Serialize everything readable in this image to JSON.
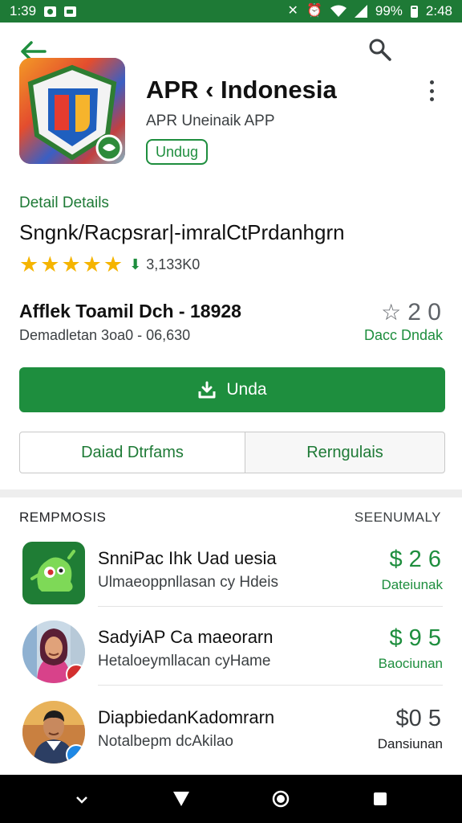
{
  "status_bar": {
    "time": "1:39",
    "battery_text": "99%",
    "clock_right": "2:48"
  },
  "app": {
    "title": "APR ‹ Indonesia",
    "subtitle": "APR Uneinaik APP",
    "chip": "Undug"
  },
  "details": {
    "label": "Detail Details",
    "title": "Sngnk/Racpsrar|-imralCtPrdanhgrn",
    "rating_stars": 5,
    "rating_count": "3,133K0"
  },
  "info": {
    "title": "Afflek Toamil Dch - 18928",
    "subtitle": "Demadletan 3oa0 - 06,630",
    "favorite_count": "2 0",
    "favorite_label": "Dacc Dndak"
  },
  "actions": {
    "install_label": "Unda",
    "left_button": "Daiad Dtrfams",
    "right_button": "Rerngulais"
  },
  "section": {
    "left_heading": "REMPMOSIS",
    "right_heading": "SEENUMALY"
  },
  "list": [
    {
      "name": "SnniPac Ihk Uad uesia",
      "desc": "Ulmaeoppnllasan cy Hdeis",
      "price": "$ 2 6",
      "price_label": "Dateiunak"
    },
    {
      "name": "SadyiAP Ca maeorarn",
      "desc": "Hetaloeymllacan cyHame",
      "price": "$ 9 5",
      "price_label": "Baociunan"
    },
    {
      "name": "DiapbiedanKadomrarn",
      "desc": "Notalbepm dcAkilao",
      "price": "$0 5",
      "price_label": "Dansiunan"
    }
  ],
  "colors": {
    "accent": "#1e8e3e",
    "status_bar": "#1e7a36",
    "star": "#f5b400"
  }
}
